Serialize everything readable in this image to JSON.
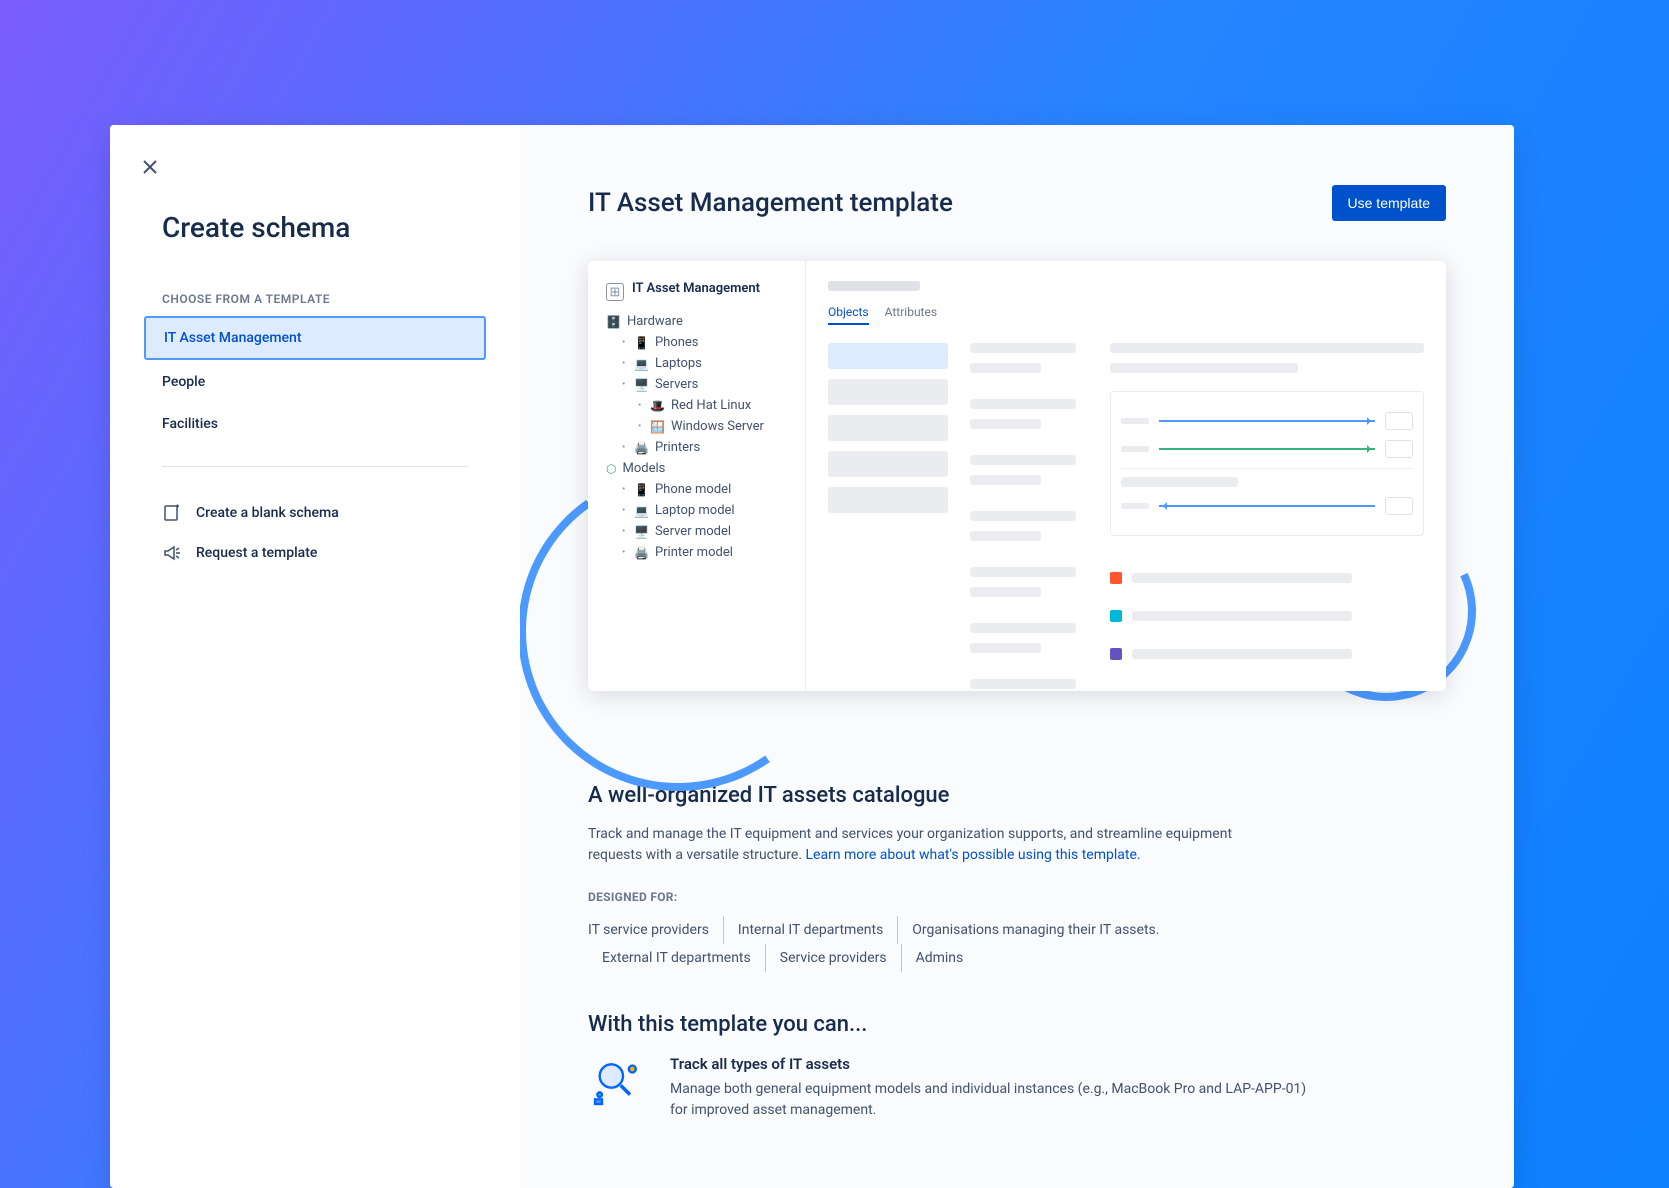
{
  "sidebar": {
    "title": "Create schema",
    "section_label": "CHOOSE FROM A TEMPLATE",
    "templates": [
      {
        "label": "IT Asset Management",
        "active": true
      },
      {
        "label": "People",
        "active": false
      },
      {
        "label": "Facilities",
        "active": false
      }
    ],
    "actions": {
      "blank": "Create a blank schema",
      "request": "Request a template"
    }
  },
  "main": {
    "title": "IT Asset Management template",
    "use_btn": "Use template"
  },
  "preview": {
    "schema_name": "IT Asset Management",
    "tabs": {
      "objects": "Objects",
      "attributes": "Attributes"
    },
    "tree": {
      "hardware": "Hardware",
      "phones": "Phones",
      "laptops": "Laptops",
      "servers": "Servers",
      "redhat": "Red Hat Linux",
      "windows": "Windows Server",
      "printers": "Printers",
      "models": "Models",
      "phone_model": "Phone model",
      "laptop_model": "Laptop model",
      "server_model": "Server model",
      "printer_model": "Printer model"
    }
  },
  "catalogue": {
    "heading": "A well-organized IT assets catalogue",
    "desc_pre": "Track and manage the IT equipment and services your organization supports, and streamline equipment requests with a versatile structure. ",
    "desc_link": "Learn more about what's possible using this template.",
    "designed_label": "DESIGNED FOR:",
    "tags": [
      "IT service providers",
      "Internal IT departments",
      "Organisations managing their IT assets.",
      "External IT departments",
      "Service providers",
      "Admins"
    ]
  },
  "can": {
    "heading": "With this template you can...",
    "feature1": {
      "title": "Track all types of IT assets",
      "desc": "Manage both general equipment models and individual instances (e.g., MacBook Pro and LAP-APP-01) for improved asset management."
    }
  }
}
